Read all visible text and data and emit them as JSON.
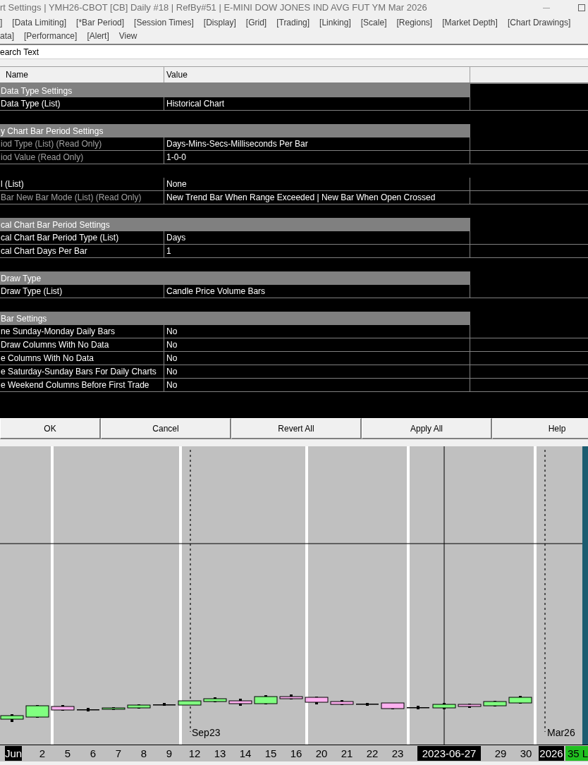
{
  "window": {
    "title": "rt Settings | YMH26-CBOT [CB]  Daily  #18 | RefBy#51 | E-MINI DOW JONES IND AVG FUT YM Mar 2026"
  },
  "tabs": [
    [
      "]",
      "[Data Limiting]",
      "[*Bar Period]",
      "[Session Times]",
      "[Display]",
      "[Grid]",
      "[Trading]",
      "[Linking]",
      "[Scale]",
      "[Regions]",
      "[Market Depth]",
      "[Chart Drawings]"
    ],
    [
      "ata]",
      "[Performance]",
      "[Alert]",
      "View"
    ]
  ],
  "search": {
    "value": "earch Text"
  },
  "table": {
    "columns": [
      "Name",
      "Value"
    ],
    "rows": [
      {
        "kind": "section",
        "name": "Data Type Settings"
      },
      {
        "kind": "setting",
        "name": "Data Type (List)",
        "value": "Historical Chart",
        "read_only": false
      },
      {
        "kind": "spacer"
      },
      {
        "kind": "section",
        "name": "y Chart Bar Period Settings"
      },
      {
        "kind": "setting",
        "name": "iod Type (List) (Read Only)",
        "value": "Days-Mins-Secs-Milliseconds Per Bar",
        "read_only": true
      },
      {
        "kind": "setting",
        "name": "iod Value (Read Only)",
        "value": "1-0-0",
        "read_only": true
      },
      {
        "kind": "spacer"
      },
      {
        "kind": "setting",
        "name": "l (List)",
        "value": "None",
        "read_only": false
      },
      {
        "kind": "setting",
        "name": "Bar New Bar Mode (List) (Read Only)",
        "value": "New Trend Bar When Range Exceeded | New Bar When Open Crossed",
        "read_only": true
      },
      {
        "kind": "spacer"
      },
      {
        "kind": "section",
        "name": "cal Chart Bar Period Settings"
      },
      {
        "kind": "setting",
        "name": "cal Chart Bar Period Type (List)",
        "value": "Days",
        "read_only": false
      },
      {
        "kind": "setting",
        "name": "cal Chart Days Per Bar",
        "value": "1",
        "read_only": false
      },
      {
        "kind": "spacer"
      },
      {
        "kind": "section",
        "name": "Draw Type"
      },
      {
        "kind": "setting",
        "name": "Draw Type (List)",
        "value": "Candle Price Volume Bars",
        "read_only": false
      },
      {
        "kind": "spacer"
      },
      {
        "kind": "section",
        "name": "Bar Settings"
      },
      {
        "kind": "setting",
        "name": "ne Sunday-Monday Daily Bars",
        "value": "No",
        "read_only": false
      },
      {
        "kind": "setting",
        "name": "Draw Columns With No Data",
        "value": "No",
        "read_only": false
      },
      {
        "kind": "setting",
        "name": "e Columns With No Data",
        "value": "No",
        "read_only": false
      },
      {
        "kind": "setting",
        "name": "e Saturday-Sunday Bars For Daily Charts",
        "value": "No",
        "read_only": false
      },
      {
        "kind": "setting",
        "name": "e Weekend Columns Before First Trade",
        "value": "No",
        "read_only": false
      }
    ]
  },
  "buttons": [
    "OK",
    "Cancel",
    "Revert All",
    "Apply All",
    "Help"
  ],
  "chart": {
    "markers": [
      "Sep23",
      "Mar26"
    ],
    "axis_labels": [
      {
        "text": "Jun",
        "selected": true
      },
      {
        "text": "2",
        "selected": false
      },
      {
        "text": "5",
        "selected": false
      },
      {
        "text": "6",
        "selected": false
      },
      {
        "text": "7",
        "selected": false
      },
      {
        "text": "8",
        "selected": false
      },
      {
        "text": "9",
        "selected": false
      },
      {
        "text": "12",
        "selected": false
      },
      {
        "text": "13",
        "selected": false
      },
      {
        "text": "14",
        "selected": false
      },
      {
        "text": "15",
        "selected": false
      },
      {
        "text": "16",
        "selected": false
      },
      {
        "text": "20",
        "selected": false
      },
      {
        "text": "21",
        "selected": false
      },
      {
        "text": "22",
        "selected": false
      },
      {
        "text": "23",
        "selected": false
      },
      {
        "text": "2023-06-27",
        "selected": true
      },
      {
        "text": "29",
        "selected": false
      },
      {
        "text": "30",
        "selected": false
      },
      {
        "text": "2026",
        "selected": true
      }
    ],
    "badge": "35 L"
  }
}
